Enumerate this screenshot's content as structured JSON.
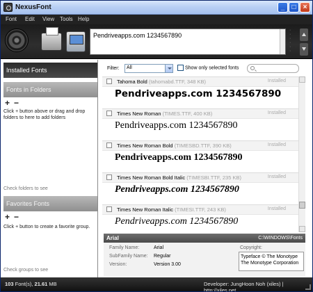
{
  "window": {
    "title": "NexusFont"
  },
  "menu": [
    "Font",
    "Edit",
    "View",
    "Tools",
    "Help"
  ],
  "preview": {
    "text": "Pendriveapps.com 1234567890"
  },
  "left": {
    "installed_label": "Installed Fonts",
    "folders_label": "Fonts in Folders",
    "folders_help": "Click + button above or drag and drop folders to here to add folders",
    "folders_hint": "Check folders to see",
    "favorites_label": "Favorites Fonts",
    "favorites_help": "Click + button to create a favorite group.",
    "groups_hint": "Check groups to see",
    "plus": "+",
    "minus": "−"
  },
  "filter": {
    "label": "Filter:",
    "selected": "All",
    "show_selected_label": "Show only selected fonts",
    "search_placeholder": ""
  },
  "fonts": [
    {
      "name": "Tahoma Bold",
      "file": "(tahomabd.TTF, 348 KB)",
      "status": "Installed",
      "sample": "Pendriveapps.com 1234567890"
    },
    {
      "name": "Times New Roman",
      "file": "(TIMES.TTF, 400 KB)",
      "status": "Installed",
      "sample": "Pendriveapps.com 1234567890"
    },
    {
      "name": "Times New Roman Bold",
      "file": "(TIMESBD.TTF, 390 KB)",
      "status": "Installed",
      "sample": "Pendriveapps.com 1234567890"
    },
    {
      "name": "Times New Roman Bold Italic",
      "file": "(TIMESBI.TTF, 235 KB)",
      "status": "Installed",
      "sample": "Pendriveapps.com 1234567890"
    },
    {
      "name": "Times New Roman Italic",
      "file": "(TIMESI.TTF, 243 KB)",
      "status": "Installed",
      "sample": "Pendriveapps.com 1234567890"
    }
  ],
  "info": {
    "font": "Arial",
    "path": "C:\\WINDOWS\\Fonts",
    "family_label": "Family Name:",
    "family_value": "Arial",
    "subfamily_label": "SubFamily Name:",
    "subfamily_value": "Regular",
    "version_label": "Version:",
    "version_value": "Version 3.00",
    "copyright_label": "Copyright:",
    "copyright_line1": "Typeface © The Monotype",
    "copyright_line2": "The Monotype Corporation"
  },
  "status": {
    "count": "103",
    "count_label": "Font(s),",
    "size": "21.61",
    "size_unit": "MB",
    "developer": "Developer: JungHoon Noh (xiles)  |  http://xiles.net"
  }
}
